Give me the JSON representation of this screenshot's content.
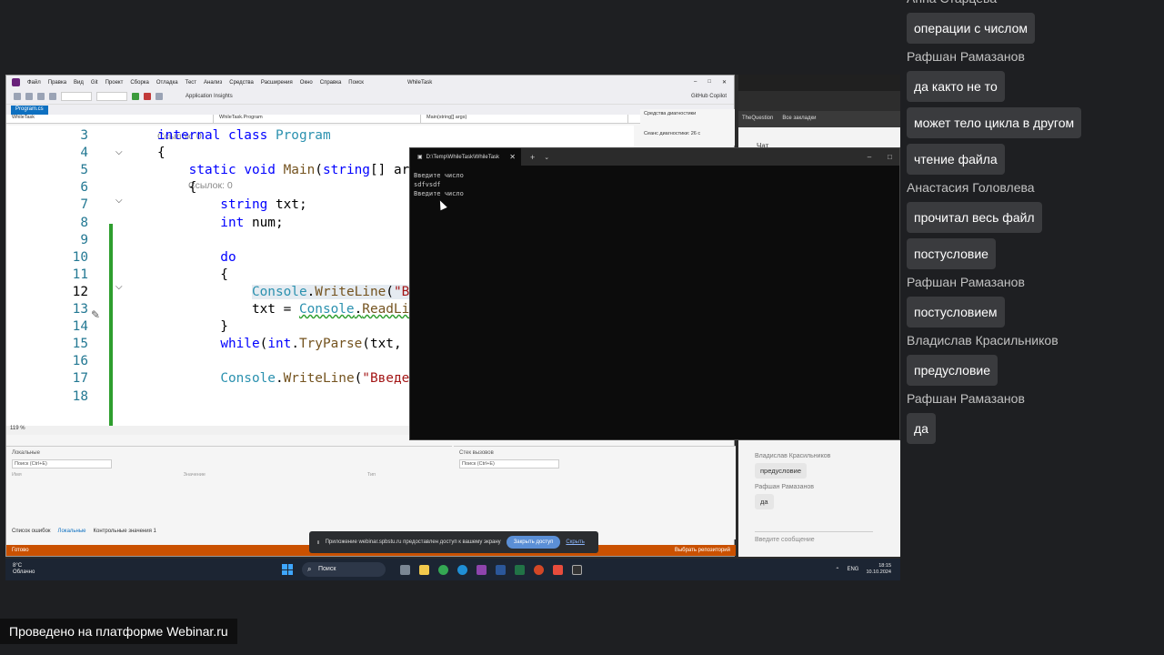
{
  "screen": {
    "vs": {
      "menu": [
        "Файл",
        "Правка",
        "Вид",
        "Git",
        "Проект",
        "Сборка",
        "Отладка",
        "Тест",
        "Анализ",
        "Средства",
        "Расширения",
        "Окно",
        "Справка",
        "Поиск"
      ],
      "window_title": "WhileTask",
      "toolbar_insights": "Application Insights",
      "github_copilot": "GitHub Copilot",
      "doc_tab": "Program.cs",
      "nav": [
        "WhileTask",
        "WhileTask.Program",
        "Main(string[] args)"
      ],
      "refs_class": "Ссылок: 0",
      "refs_main": "Ссылок: 0",
      "code_lines": [
        {
          "n": "3",
          "parts": [
            {
              "t": "internal ",
              "c": "kw"
            },
            {
              "t": "class ",
              "c": "kw"
            },
            {
              "t": "Program",
              "c": "ty"
            }
          ]
        },
        {
          "n": "4",
          "parts": [
            {
              "t": "{",
              "c": ""
            }
          ]
        },
        {
          "n": "5",
          "parts": [
            {
              "t": "    static ",
              "c": "kw"
            },
            {
              "t": "void ",
              "c": "kw"
            },
            {
              "t": "Main",
              "c": "mt"
            },
            {
              "t": "(",
              "c": ""
            },
            {
              "t": "string",
              "c": "kw"
            },
            {
              "t": "[] ar",
              "c": ""
            }
          ]
        },
        {
          "n": "6",
          "parts": [
            {
              "t": "    {",
              "c": ""
            }
          ]
        },
        {
          "n": "7",
          "parts": [
            {
              "t": "        string ",
              "c": "kw"
            },
            {
              "t": "txt;",
              "c": ""
            }
          ]
        },
        {
          "n": "8",
          "parts": [
            {
              "t": "        int ",
              "c": "kw"
            },
            {
              "t": "num;",
              "c": ""
            }
          ]
        },
        {
          "n": "9",
          "parts": []
        },
        {
          "n": "10",
          "parts": [
            {
              "t": "        do",
              "c": "kw"
            }
          ]
        },
        {
          "n": "11",
          "parts": [
            {
              "t": "        {",
              "c": ""
            }
          ]
        },
        {
          "n": "12",
          "parts": [
            {
              "t": "            ",
              "c": ""
            },
            {
              "t": "Console",
              "c": "ty hl"
            },
            {
              "t": ".",
              "c": "hl"
            },
            {
              "t": "WriteLine",
              "c": "mt hl"
            },
            {
              "t": "(",
              "c": "hl"
            },
            {
              "t": "\"В",
              "c": "st hl"
            }
          ]
        },
        {
          "n": "13",
          "parts": [
            {
              "t": "            txt = ",
              "c": ""
            },
            {
              "t": "Console",
              "c": "ty err"
            },
            {
              "t": ".",
              "c": "err"
            },
            {
              "t": "ReadLi",
              "c": "mt err"
            }
          ]
        },
        {
          "n": "14",
          "parts": [
            {
              "t": "        }",
              "c": ""
            }
          ]
        },
        {
          "n": "15",
          "parts": [
            {
              "t": "        ",
              "c": ""
            },
            {
              "t": "while",
              "c": "kw"
            },
            {
              "t": "(",
              "c": ""
            },
            {
              "t": "int",
              "c": "kw"
            },
            {
              "t": ".",
              "c": ""
            },
            {
              "t": "TryParse",
              "c": "mt"
            },
            {
              "t": "(txt, ",
              "c": ""
            }
          ]
        },
        {
          "n": "16",
          "parts": []
        },
        {
          "n": "17",
          "parts": [
            {
              "t": "        ",
              "c": ""
            },
            {
              "t": "Console",
              "c": "ty"
            },
            {
              "t": ".",
              "c": ""
            },
            {
              "t": "WriteLine",
              "c": "mt"
            },
            {
              "t": "(",
              "c": ""
            },
            {
              "t": "\"Введе",
              "c": "st"
            }
          ]
        },
        {
          "n": "18",
          "parts": []
        }
      ],
      "current_line": "12",
      "zoom": "119 %",
      "diag_title": "Средства диагностики",
      "diag_session": "Сеанс диагностики: 26 с",
      "locals_title": "Локальные",
      "locals_search": "Поиск (Ctrl+E)",
      "watch_title": "Стек вызовов",
      "watch_search": "Поиск (Ctrl+E)",
      "col_name": "Имя",
      "col_value": "Значение",
      "col_type": "Тип",
      "bottom_tabs": [
        "Список ошибок",
        "Локальные",
        "Контрольные значения 1"
      ],
      "status_ready": "Готово",
      "status_repo": "Выбрать репозиторий"
    },
    "terminal": {
      "tab_title": "D:\\Temp\\WhileTask\\WhileTask",
      "lines": [
        "Введите число",
        "sdfvsdf",
        "Введите число"
      ]
    },
    "share_bar": {
      "text": "Приложение webinar.spbstu.ru предоставлен доступ к вашему экрану",
      "stop_button": "Закрыть доступ",
      "hide_link": "Скрыть"
    },
    "browser": {
      "bookmark": "TheQuestion",
      "bookmarks_all": "Все закладки",
      "chat_header": "Чат",
      "chat": [
        {
          "author": "Владислав Красильников",
          "text": "предусловие"
        },
        {
          "author": "Рафшан Рамазанов",
          "text": "да"
        }
      ],
      "input_placeholder": "Введите сообщение"
    },
    "taskbar": {
      "weather_temp": "8°C",
      "weather_desc": "Облачно",
      "search": "Поиск",
      "lang": "ENG",
      "time": "18:15",
      "date": "10.10.2024"
    }
  },
  "chat": {
    "messages": [
      {
        "type": "author",
        "text": "Анна Старцева"
      },
      {
        "type": "bubble",
        "text": "операции с числом"
      },
      {
        "type": "author",
        "text": "Рафшан Рамазанов"
      },
      {
        "type": "bubble",
        "text": "да както не то"
      },
      {
        "type": "bubble",
        "text": "может тело цикла в другом"
      },
      {
        "type": "bubble",
        "text": "чтение файла"
      },
      {
        "type": "author",
        "text": "Анастасия Головлева"
      },
      {
        "type": "bubble",
        "text": "прочитал весь файл"
      },
      {
        "type": "bubble",
        "text": "постусловие"
      },
      {
        "type": "author",
        "text": "Рафшан Рамазанов"
      },
      {
        "type": "bubble",
        "text": "постусловием"
      },
      {
        "type": "author",
        "text": "Владислав Красильников"
      },
      {
        "type": "bubble",
        "text": "предусловие"
      },
      {
        "type": "author",
        "text": "Рафшан Рамазанов"
      },
      {
        "type": "bubble",
        "text": "да"
      }
    ]
  },
  "branding": "Проведено на платформе Webinar.ru"
}
